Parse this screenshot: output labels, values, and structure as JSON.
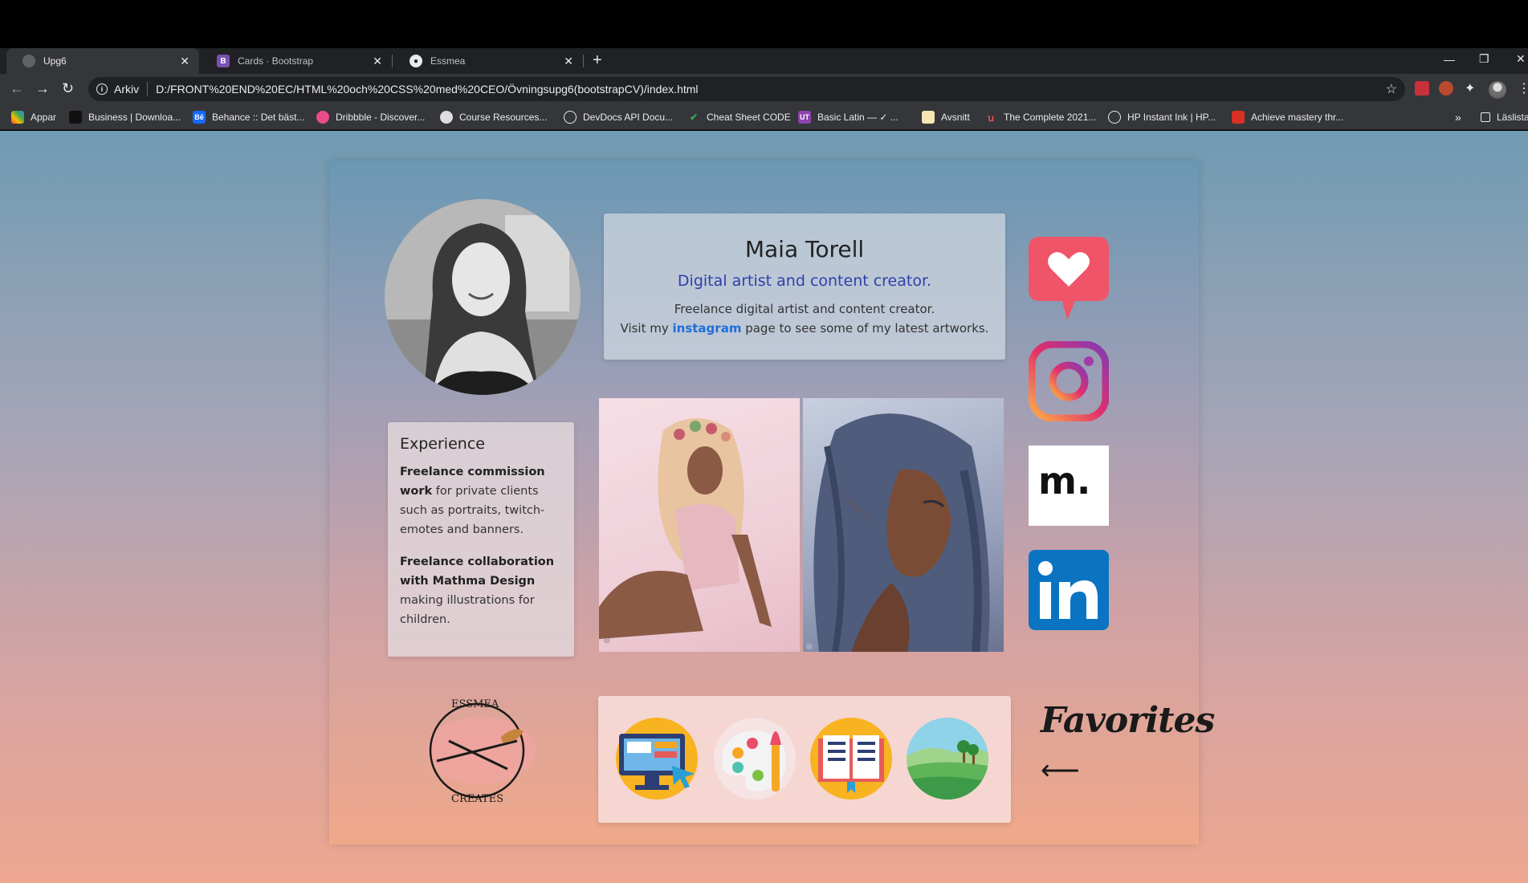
{
  "browser": {
    "tabs": [
      {
        "title": "Upg6",
        "active": true
      },
      {
        "title": "Cards · Bootstrap",
        "active": false
      },
      {
        "title": "Essmea",
        "active": false
      }
    ],
    "address": {
      "scheme_label": "Arkiv",
      "url": "D:/FRONT%20END%20EC/HTML%20och%20CSS%20med%20CEO/Övningsupg6(bootstrapCV)/index.html"
    },
    "bookmarks": [
      {
        "label": "Appar",
        "icon": "apps-grid-icon",
        "color": "#ea4335"
      },
      {
        "label": "Business | Downloa...",
        "icon": "business-icon",
        "color": "#222222"
      },
      {
        "label": "Behance :: Det bäst...",
        "icon": "behance-icon",
        "color": "#1769ff"
      },
      {
        "label": "Dribbble - Discover...",
        "icon": "dribbble-icon",
        "color": "#ea4c89"
      },
      {
        "label": "Course Resources...",
        "icon": "course-icon",
        "color": "#dddddd"
      },
      {
        "label": "DevDocs API Docu...",
        "icon": "globe-icon",
        "color": "#e8eaed"
      },
      {
        "label": "Cheat Sheet CODE",
        "icon": "cheatsheet-icon",
        "color": "#34a853"
      },
      {
        "label": "Basic Latin — ✓ ...",
        "icon": "unicode-icon",
        "color": "#8e44ad"
      },
      {
        "label": "Avsnitt",
        "icon": "avsnitt-icon",
        "color": "#f5e6b3"
      },
      {
        "label": "The Complete 2021...",
        "icon": "udemy-icon",
        "color": "#ec5252"
      },
      {
        "label": "HP Instant Ink | HP...",
        "icon": "globe-icon",
        "color": "#e8eaed"
      },
      {
        "label": "Achieve mastery thr...",
        "icon": "mastery-icon",
        "color": "#d93025"
      }
    ],
    "reading_list": "Läslista"
  },
  "profile": {
    "name": "Maia Torell",
    "role": "Digital artist and content creator.",
    "desc_line1": "Freelance digital artist and content creator.",
    "desc_prefix": "Visit my ",
    "desc_link": "instagram",
    "desc_suffix": " page to see some of my latest artworks."
  },
  "experience": {
    "title": "Experience",
    "item1_bold": "Freelance commission work",
    "item1_text": " for private clients such as portraits, twitch-emotes and banners.",
    "item2_bold": "Freelance collaboration with Mathma Design",
    "item2_text": " making illustrations for children."
  },
  "logo": {
    "top_text": "ESSMEA",
    "bottom_text": "CREATES"
  },
  "favorites": {
    "title": "Favorites",
    "arrow": "⟵"
  },
  "social": {
    "tumblr_like_color": "#ef5468",
    "instagram_colors": [
      "#fcaf45",
      "#e1306c",
      "#833ab4"
    ],
    "mathma_text": "m.",
    "linkedin_color": "#0a74c2"
  }
}
